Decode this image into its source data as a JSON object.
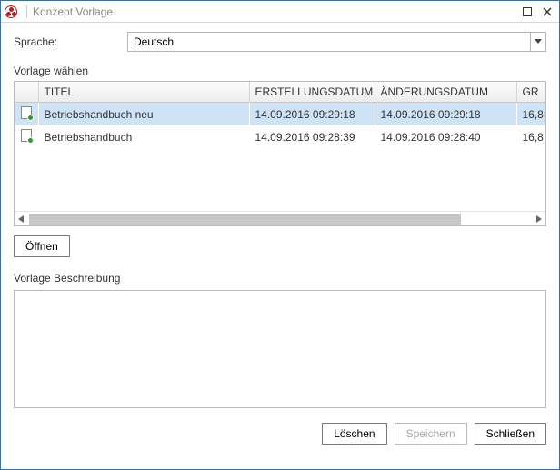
{
  "window": {
    "title": "Konzept Vorlage"
  },
  "labels": {
    "sprache": "Sprache:",
    "vorlage_waehlen": "Vorlage wählen",
    "vorlage_beschreibung": "Vorlage Beschreibung"
  },
  "language": {
    "value": "Deutsch"
  },
  "grid": {
    "columns": {
      "icon": "",
      "titel": "TITEL",
      "erstellungsdatum": "ERSTELLUNGSDATUM",
      "aenderungsdatum": "ÄNDERUNGSDATUM",
      "gr": "GR"
    },
    "rows": [
      {
        "titel": "Betriebshandbuch neu",
        "erst": "14.09.2016 09:29:18",
        "aend": "14.09.2016 09:29:18",
        "gr": "16,8",
        "selected": true
      },
      {
        "titel": "Betriebshandbuch",
        "erst": "14.09.2016 09:28:39",
        "aend": "14.09.2016 09:28:40",
        "gr": "16,8",
        "selected": false
      }
    ]
  },
  "buttons": {
    "oeffnen": "Öffnen",
    "loeschen": "Löschen",
    "speichern": "Speichern",
    "schliessen": "Schließen"
  }
}
